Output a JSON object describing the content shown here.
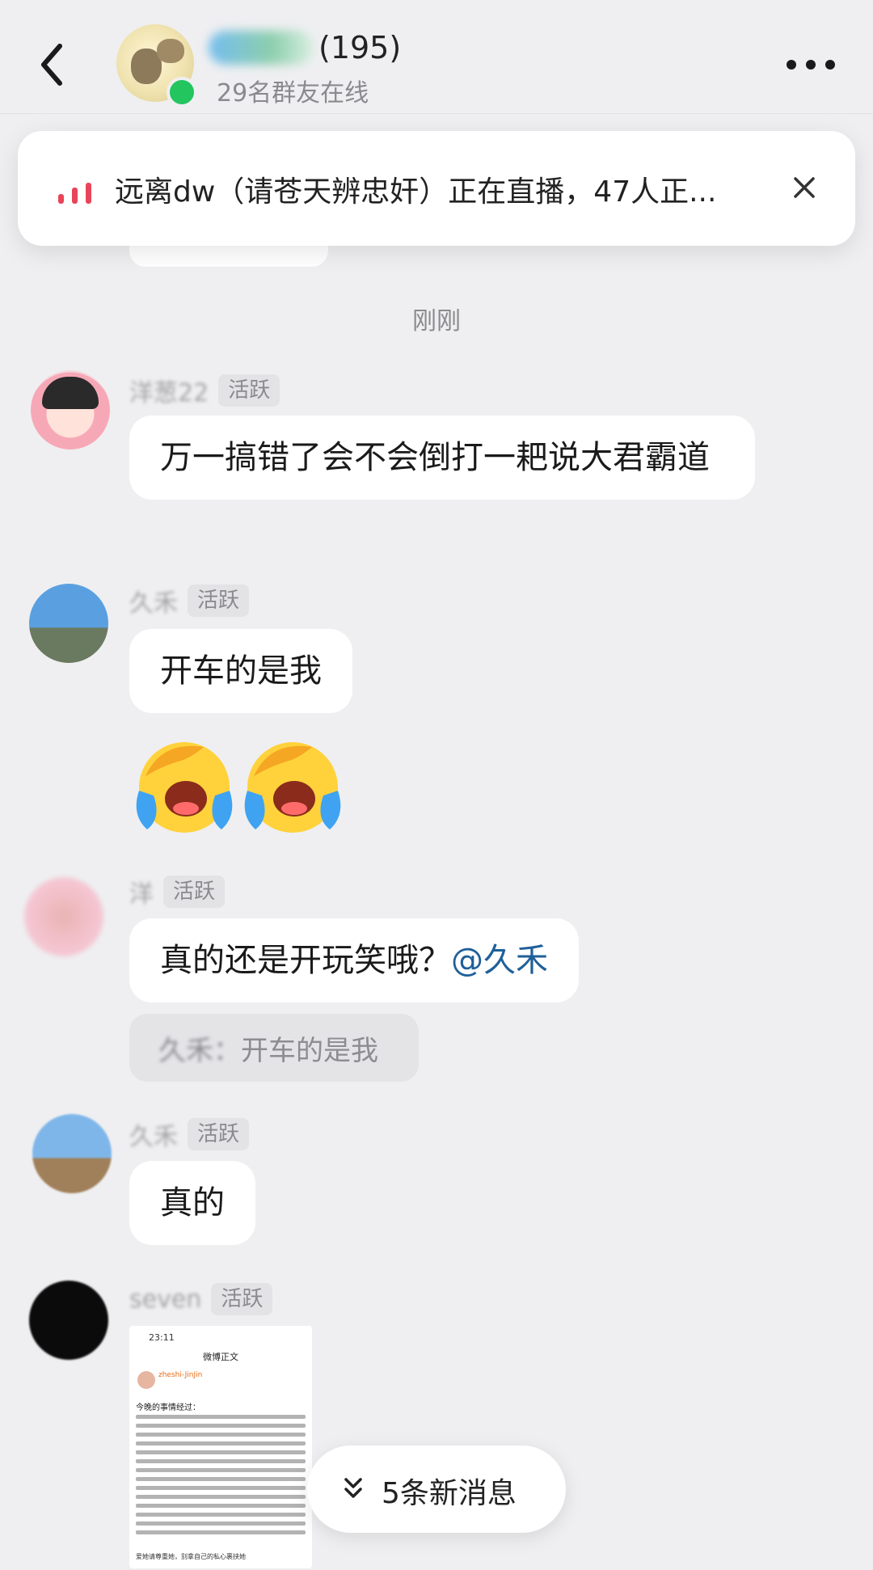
{
  "header": {
    "title_count": "(195)",
    "online_text": "29名群友在线"
  },
  "banner": {
    "text": "远离dw（请苍天辨忠奸）正在直播，47人正..."
  },
  "time_divider": "刚刚",
  "messages": [
    {
      "name": "洋葱22",
      "badge": "活跃",
      "text": "万一搞错了会不会倒打一耙说大君霸道"
    },
    {
      "name": "久禾",
      "badge": "活跃",
      "text": "开车的是我",
      "emoji": [
        "crying-face",
        "crying-face"
      ]
    },
    {
      "name": "洋",
      "badge": "活跃",
      "text": "真的还是开玩笑哦？",
      "mention": "@久禾",
      "quote": {
        "name": "久禾：",
        "text": "开车的是我"
      }
    },
    {
      "name": "久禾",
      "badge": "活跃",
      "text": "真的"
    },
    {
      "name": "seven",
      "badge": "活跃",
      "image": {
        "status_time": "23:11",
        "title": "微博正文",
        "user": "zheshi-JinJin",
        "head": "今晚的事情经过：",
        "footer": "爱她请尊重她，别拿自己的私心裹挟她"
      }
    }
  ],
  "new_messages": "5条新消息",
  "colors": {
    "background": "#efeff1",
    "bubble": "#ffffff",
    "online": "#22c55e",
    "live": "#e8455a",
    "mention": "#1f5f99"
  }
}
